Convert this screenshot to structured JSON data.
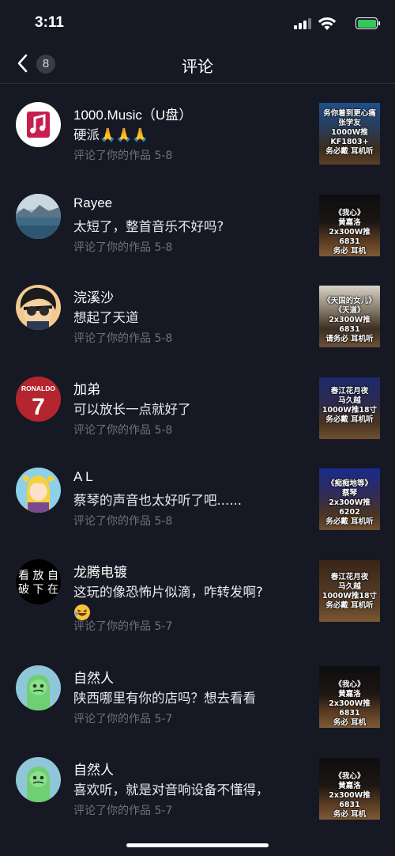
{
  "status": {
    "time": "3:11"
  },
  "nav": {
    "title": "评论",
    "unread_count": "8"
  },
  "comments": [
    {
      "name": "1000.Music（U盘）",
      "text": "硬派🙏🙏🙏",
      "meta": "评论了你的作品  5-8",
      "thumb_text": "务你着到更心痛\n张学友\n1000W推KF1803+\n务必戴  耳机听"
    },
    {
      "name": "Rayee",
      "text": "太短了，整首音乐不好吗?",
      "meta": "评论了你的作品  5-8",
      "thumb_text": "《我心》\n黄嘉洛\n2x300W推6831\n务必  耳机"
    },
    {
      "name": "浣溪沙",
      "text": "想起了天道",
      "meta": "评论了你的作品  5-8",
      "thumb_text": "《天国的女儿》\n《天道》\n2x300W推6831\n请务必  耳机听"
    },
    {
      "name": "加弟",
      "text": "可以放长一点就好了",
      "meta": "评论了你的作品  5-8",
      "thumb_text": "春江花月夜\n马久越\n1000W推18寸\n务必戴  耳机听"
    },
    {
      "name": "A L",
      "text": "蔡琴的声音也太好听了吧......",
      "meta": "评论了你的作品  5-8",
      "thumb_text": "《痴痴地等》\n蔡琴\n2x300W推6202\n务必戴  耳机听"
    },
    {
      "name": "龙腾电镀",
      "text": "这玩的像恐怖片似滴，咋转发啊?",
      "meta": "评论了你的作品  5-7",
      "thumb_text": "春江花月夜\n马久越\n1000W推18寸\n务必戴  耳机听"
    },
    {
      "name": "自然人",
      "text": "陕西哪里有你的店吗？想去看看",
      "meta": "评论了你的作品  5-7",
      "thumb_text": "《我心》\n黄嘉洛\n2x300W推6831\n务必  耳机"
    },
    {
      "name": "自然人",
      "text": "喜欢听，就是对音响设备不懂得，",
      "meta": "评论了你的作品  5-7",
      "thumb_text": "《我心》\n黄嘉洛\n2x300W推6831\n务必  耳机"
    }
  ],
  "avatar_text": {
    "ronaldo": "RONALDO",
    "number": "7",
    "calligraphy": "看 放 自\n破 下 在"
  },
  "colors": {
    "background": "#161823",
    "meta": "#6f717b",
    "battery": "#34c759"
  }
}
